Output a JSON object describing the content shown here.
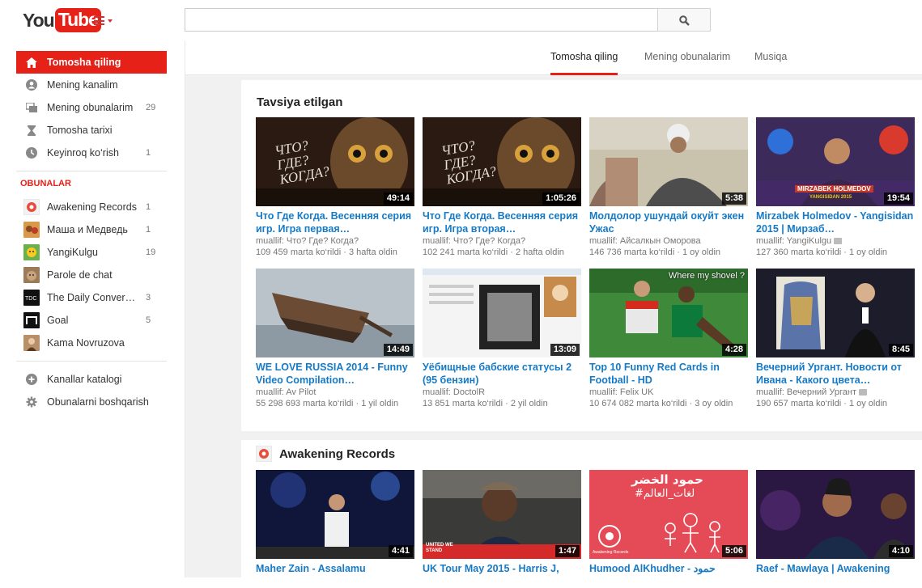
{
  "header": {
    "logo_you": "You",
    "logo_tube": "Tube",
    "search_placeholder": ""
  },
  "sidebar": {
    "items": [
      {
        "label": "Tomosha qiling",
        "count": ""
      },
      {
        "label": "Mening kanalim",
        "count": ""
      },
      {
        "label": "Mening obunalarim",
        "count": "29"
      },
      {
        "label": "Tomosha tarixi",
        "count": ""
      },
      {
        "label": "Keyinroq ko‘rish",
        "count": "1"
      }
    ],
    "subscriptions_heading": "OBUNALAR",
    "channels": [
      {
        "label": "Awakening Records",
        "count": "1"
      },
      {
        "label": "Маша и Медведь",
        "count": "1"
      },
      {
        "label": "YangiKulgu",
        "count": "19"
      },
      {
        "label": "Parole de chat",
        "count": ""
      },
      {
        "label": "The Daily Conver…",
        "count": "3"
      },
      {
        "label": "Goal",
        "count": "5"
      },
      {
        "label": "Kama Novruzova",
        "count": ""
      }
    ],
    "footer_items": [
      {
        "label": "Kanallar katalogi"
      },
      {
        "label": "Obunalarni boshqarish"
      }
    ]
  },
  "tabs": [
    {
      "label": "Tomosha qiling"
    },
    {
      "label": "Mening obunalarim"
    },
    {
      "label": "Musiqa"
    }
  ],
  "shelves": [
    {
      "title": "Tavsiya etilgan",
      "videos": [
        {
          "title": "Что Где Когда. Весенняя серия игр. Игра первая…",
          "author": "muallif: Что? Где? Когда?",
          "views": "109 459 marta ko‘rildi",
          "age": "3 hafta oldin",
          "duration": "49:14"
        },
        {
          "title": "Что Где Когда. Весенняя серия игр. Игра вторая…",
          "author": "muallif: Что? Где? Когда?",
          "views": "102 241 marta ko‘rildi",
          "age": "2 hafta oldin",
          "duration": "1:05:26"
        },
        {
          "title": "Молдолор ушундай окуйт экен Ужас",
          "author": "muallif: Айсалкын Оморова",
          "views": "146 736 marta ko‘rildi",
          "age": "1 oy oldin",
          "duration": "5:38"
        },
        {
          "title": "Mirzabek Holmedov - Yangisidan 2015 | Мирзаб…",
          "author": "muallif: YangiKulgu",
          "views": "127 360 marta ko‘rildi",
          "age": "1 oy oldin",
          "duration": "19:54"
        },
        {
          "title": "WE LOVE RUSSIA 2014 - Funny Video Compilation…",
          "author": "muallif: Av Pilot",
          "views": "55 298 693 marta ko‘rildi",
          "age": "1 yil oldin",
          "duration": "14:49"
        },
        {
          "title": "Уёбищные бабские статусы 2 (95 бензин)",
          "author": "muallif: DoctolR",
          "views": "13 851 marta ko‘rildi",
          "age": "2 yil oldin",
          "duration": "13:09"
        },
        {
          "title": "Top 10 Funny Red Cards in Football - HD",
          "author": "muallif: Felix UK",
          "views": "10 674 082 marta ko‘rildi",
          "age": "3 oy oldin",
          "duration": "4:28"
        },
        {
          "title": "Вечерний Ургант. Новости от Ивана - Какого цвета…",
          "author": "muallif: Вечерний Ургант",
          "views": "190 657 marta ko‘rildi",
          "age": "1 oy oldin",
          "duration": "8:45"
        }
      ]
    },
    {
      "title": "Awakening Records",
      "videos": [
        {
          "title": "Maher Zain - Assalamu",
          "duration": "4:41"
        },
        {
          "title": "UK Tour May 2015 - Harris J,",
          "duration": "1:47"
        },
        {
          "title": "Humood AlKhudher - حمود",
          "duration": "5:06"
        },
        {
          "title": "Raef - Mawlaya | Awakening",
          "duration": "4:10"
        }
      ]
    }
  ],
  "thumb_overlays": {
    "chgk": "ЧТО? ГДЕ? КОГДА?",
    "mirzabek": "MIRZABEK HOLMEDOV",
    "mirzabek_sub": "YANGISIDAN 2015",
    "shovel": "Where my shovel ?",
    "humood_ar": "حمود الخضر",
    "humood_ar2": "#لغات_العالم",
    "awakening": "Awakening Records",
    "united": "UNITED WE STAND"
  },
  "colors": {
    "accent": "#e62117",
    "link": "#167ac6"
  }
}
